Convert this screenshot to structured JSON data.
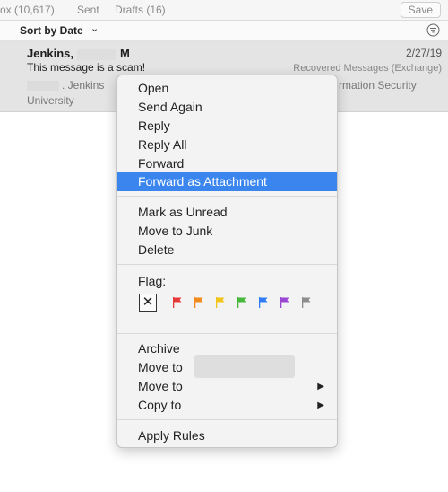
{
  "toolbar": {
    "inbox_label": "ox (10,617)",
    "sent_label": "Sent",
    "drafts_label": "Drafts (16)",
    "save_label": "Save"
  },
  "sortbar": {
    "label": "Sort by Date",
    "chevron": "⌄"
  },
  "message": {
    "sender_prefix": "Jenkins,",
    "sender_suffix": "M",
    "date": "2/27/19",
    "subject": "This message is a scam!",
    "folder": "Recovered Messages (Exchange)",
    "preview_name_suffix": ". Jenkins",
    "preview_right": "rmation Security",
    "preview_line2": "University"
  },
  "menu": {
    "open": "Open",
    "send_again": "Send Again",
    "reply": "Reply",
    "reply_all": "Reply All",
    "forward": "Forward",
    "forward_attachment": "Forward as Attachment",
    "mark_unread": "Mark as Unread",
    "move_junk": "Move to Junk",
    "delete": "Delete",
    "flag_label": "Flag:",
    "flag_clear": "✕",
    "archive": "Archive",
    "move_to": "Move to",
    "move_to_sub": "Move to",
    "copy_to": "Copy to",
    "apply_rules": "Apply Rules",
    "submenu_arrow": "▶"
  },
  "colors": {
    "highlight": "#3b86ee",
    "flag_red": "#e8393a",
    "flag_orange": "#f08a1c",
    "flag_yellow": "#f2c419",
    "flag_green": "#45b83a",
    "flag_blue": "#2f7cf5",
    "flag_purple": "#9a47d6",
    "flag_gray": "#8d8d8d"
  }
}
